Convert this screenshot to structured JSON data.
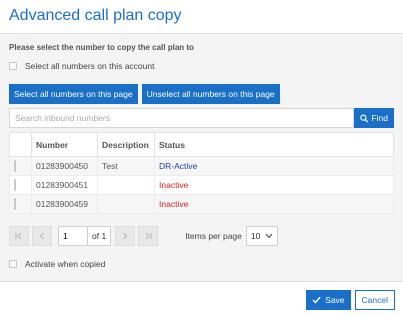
{
  "dialog": {
    "title": "Advanced call plan copy",
    "instruction": "Please select the number to copy the call plan to",
    "select_all_account_label": "Select all numbers on this account",
    "select_page_button": "Select all numbers on this page",
    "unselect_page_button": "Unselect all numbers on this page",
    "search": {
      "placeholder": "Search inbound numbers",
      "value": ""
    },
    "find_button": "Find",
    "table": {
      "headers": [
        "Number",
        "Description",
        "Status"
      ],
      "rows": [
        {
          "number": "01283900450",
          "description": "Test",
          "status": "DR-Active"
        },
        {
          "number": "01283900451",
          "description": "",
          "status": "Inactive"
        },
        {
          "number": "01283900459",
          "description": "",
          "status": "Inactive"
        }
      ]
    },
    "pager": {
      "page": "1",
      "of_label": "of 1",
      "items_per_page_label": "Items per page",
      "items_per_page": "10"
    },
    "activate_label": "Activate when copied",
    "save_button": "Save",
    "cancel_button": "Cancel"
  },
  "colors": {
    "accent": "#1a6fc9",
    "active_status": "#1a3fb0",
    "inactive_status": "#e02020"
  }
}
